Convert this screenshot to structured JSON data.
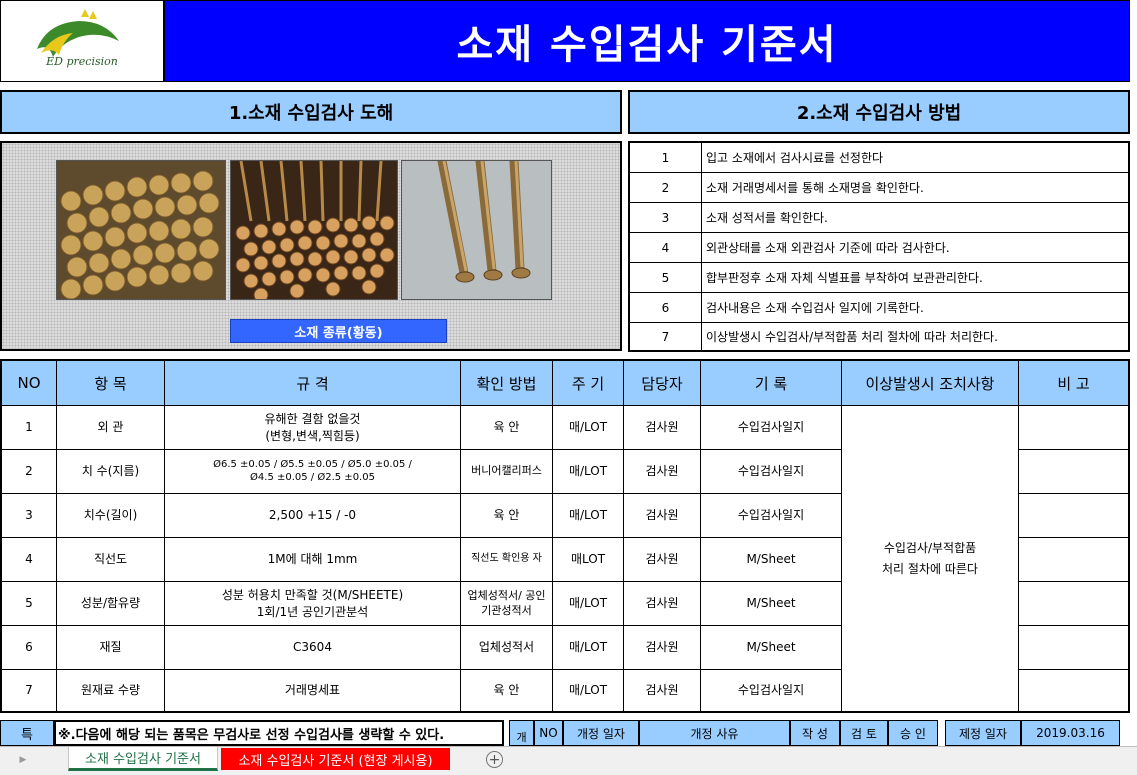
{
  "header": {
    "logo_text": "ED precision",
    "title": "소재 수입검사 기준서"
  },
  "section1": {
    "title": "1.소재 수입검사 도해",
    "material_type": "소재 종류(황동)"
  },
  "section2": {
    "title": "2.소재 수입검사 방법",
    "steps": [
      {
        "no": "1",
        "text": "입고 소재에서 검사시료를 선정한다"
      },
      {
        "no": "2",
        "text": "소재 거래명세서를 통해 소재명을 확인한다."
      },
      {
        "no": "3",
        "text": "소재 성적서를 확인한다."
      },
      {
        "no": "4",
        "text": "외관상태를 소재 외관검사 기준에 따라 검사한다."
      },
      {
        "no": "5",
        "text": "합부판정후 소재 자체 식별표를 부착하여 보관관리한다."
      },
      {
        "no": "6",
        "text": "검사내용은 소재 수입검사 일지에 기록한다."
      },
      {
        "no": "7",
        "text": "이상발생시 수입검사/부적합품 처리 절차에 따라 처리한다."
      }
    ]
  },
  "table": {
    "headers": [
      "NO",
      "항  목",
      "규  격",
      "확인 방법",
      "주  기",
      "담당자",
      "기  록",
      "이상발생시 조치사항",
      "비  고"
    ],
    "rows": [
      {
        "no": "1",
        "item": "외   관",
        "spec1": "유해한 결함 없을것",
        "spec2": "(변형,변색,찍힘등)",
        "method": "육   안",
        "cycle": "매/LOT",
        "owner": "검사원",
        "record": "수입검사일지"
      },
      {
        "no": "2",
        "item": "치 수(지름)",
        "spec1": "Ø6.5 ±0.05 / Ø5.5 ±0.05 / Ø5.0 ±0.05 /",
        "spec2": "Ø4.5 ±0.05 / Ø2.5 ±0.05",
        "method": "버니어캘리퍼스",
        "cycle": "매/LOT",
        "owner": "검사원",
        "record": "수입검사일지"
      },
      {
        "no": "3",
        "item": "치수(길이)",
        "spec1": "2,500  +15  /  -0",
        "spec2": "",
        "method": "육   안",
        "cycle": "매/LOT",
        "owner": "검사원",
        "record": "수입검사일지"
      },
      {
        "no": "4",
        "item": "직선도",
        "spec1": "1M에 대해 1mm",
        "spec2": "",
        "method": "직선도 확인용 자",
        "cycle": "매LOT",
        "owner": "검사원",
        "record": "M/Sheet"
      },
      {
        "no": "5",
        "item": "성분/함유량",
        "spec1": "성분 허용치 만족할 것(M/SHEETE)",
        "spec2": "1회/1년 공인기관분석",
        "method": "업체성적서/ 공인기관성적서",
        "cycle": "매/LOT",
        "owner": "검사원",
        "record": "M/Sheet"
      },
      {
        "no": "6",
        "item": "재질",
        "spec1": "C3604",
        "spec2": "",
        "method": "업체성적서",
        "cycle": "매/LOT",
        "owner": "검사원",
        "record": "M/Sheet"
      },
      {
        "no": "7",
        "item": "원재료 수량",
        "spec1": "거래명세표",
        "spec2": "",
        "method": "육   안",
        "cycle": "매/LOT",
        "owner": "검사원",
        "record": "수입검사일지"
      }
    ],
    "action_line1": "수입검사/부적합품",
    "action_line2": "처리 절차에 따른다"
  },
  "footer": {
    "special_label": "특",
    "special_note": "※.다음에 해당 되는 품목은 무검사로 선정 수입검사를 생략할 수 있다.",
    "revision_label": "개",
    "revision_headers": {
      "no": "NO",
      "date": "개정 일자",
      "reason": "개정 사유",
      "author": "작  성",
      "review": "검  토",
      "approve": "승  인"
    },
    "enact_label": "제정 일자",
    "enact_date": "2019.03.16"
  },
  "sheets": {
    "tab1": "소재 수입검사 기준서",
    "tab2": "소재 수입검사 기준서 (현장 게시용)",
    "add": "+",
    "nav": "▶"
  },
  "colors": {
    "title_bg": "#0000ff",
    "header_bg": "#99ccff",
    "tab2_bg": "#ff0000",
    "label_bg": "#3366ff"
  }
}
